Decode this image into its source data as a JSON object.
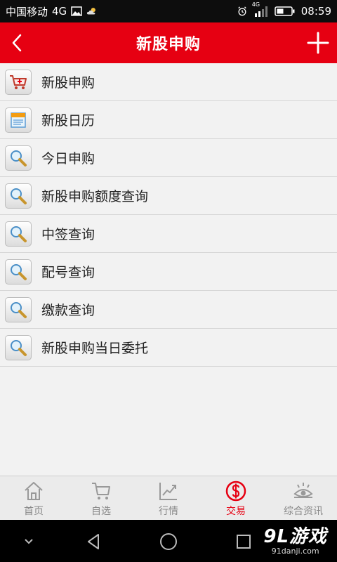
{
  "statusbar": {
    "carrier": "中国移动",
    "network": "4G",
    "signal_label": "4G",
    "time": "08:59"
  },
  "titlebar": {
    "title": "新股申购"
  },
  "list": {
    "items": [
      {
        "label": "新股申购",
        "icon": "shopping-cart-icon"
      },
      {
        "label": "新股日历",
        "icon": "calendar-icon"
      },
      {
        "label": "今日申购",
        "icon": "magnifier-icon"
      },
      {
        "label": "新股申购额度查询",
        "icon": "magnifier-icon"
      },
      {
        "label": "中签查询",
        "icon": "magnifier-icon"
      },
      {
        "label": "配号查询",
        "icon": "magnifier-icon"
      },
      {
        "label": "缴款查询",
        "icon": "magnifier-icon"
      },
      {
        "label": "新股申购当日委托",
        "icon": "magnifier-icon"
      }
    ]
  },
  "tabbar": {
    "tabs": [
      {
        "label": "首页",
        "icon": "home-icon"
      },
      {
        "label": "自选",
        "icon": "cart-icon"
      },
      {
        "label": "行情",
        "icon": "chart-icon"
      },
      {
        "label": "交易",
        "icon": "dollar-icon",
        "active": true
      },
      {
        "label": "综合资讯",
        "icon": "eye-icon"
      }
    ]
  },
  "watermark": {
    "brand": "9L游戏",
    "site": "91danji.com"
  },
  "colors": {
    "accent": "#e60012",
    "tab_inactive": "#888888"
  }
}
